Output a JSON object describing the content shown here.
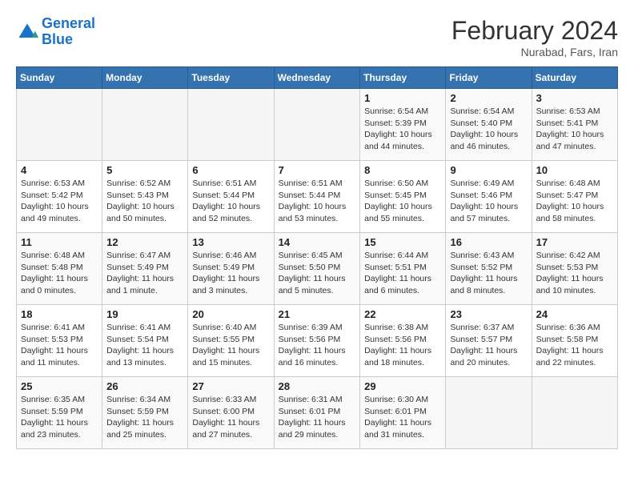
{
  "header": {
    "logo_line1": "General",
    "logo_line2": "Blue",
    "month_title": "February 2024",
    "location": "Nurabad, Fars, Iran"
  },
  "weekdays": [
    "Sunday",
    "Monday",
    "Tuesday",
    "Wednesday",
    "Thursday",
    "Friday",
    "Saturday"
  ],
  "weeks": [
    [
      {
        "day": "",
        "info": ""
      },
      {
        "day": "",
        "info": ""
      },
      {
        "day": "",
        "info": ""
      },
      {
        "day": "",
        "info": ""
      },
      {
        "day": "1",
        "info": "Sunrise: 6:54 AM\nSunset: 5:39 PM\nDaylight: 10 hours\nand 44 minutes."
      },
      {
        "day": "2",
        "info": "Sunrise: 6:54 AM\nSunset: 5:40 PM\nDaylight: 10 hours\nand 46 minutes."
      },
      {
        "day": "3",
        "info": "Sunrise: 6:53 AM\nSunset: 5:41 PM\nDaylight: 10 hours\nand 47 minutes."
      }
    ],
    [
      {
        "day": "4",
        "info": "Sunrise: 6:53 AM\nSunset: 5:42 PM\nDaylight: 10 hours\nand 49 minutes."
      },
      {
        "day": "5",
        "info": "Sunrise: 6:52 AM\nSunset: 5:43 PM\nDaylight: 10 hours\nand 50 minutes."
      },
      {
        "day": "6",
        "info": "Sunrise: 6:51 AM\nSunset: 5:44 PM\nDaylight: 10 hours\nand 52 minutes."
      },
      {
        "day": "7",
        "info": "Sunrise: 6:51 AM\nSunset: 5:44 PM\nDaylight: 10 hours\nand 53 minutes."
      },
      {
        "day": "8",
        "info": "Sunrise: 6:50 AM\nSunset: 5:45 PM\nDaylight: 10 hours\nand 55 minutes."
      },
      {
        "day": "9",
        "info": "Sunrise: 6:49 AM\nSunset: 5:46 PM\nDaylight: 10 hours\nand 57 minutes."
      },
      {
        "day": "10",
        "info": "Sunrise: 6:48 AM\nSunset: 5:47 PM\nDaylight: 10 hours\nand 58 minutes."
      }
    ],
    [
      {
        "day": "11",
        "info": "Sunrise: 6:48 AM\nSunset: 5:48 PM\nDaylight: 11 hours\nand 0 minutes."
      },
      {
        "day": "12",
        "info": "Sunrise: 6:47 AM\nSunset: 5:49 PM\nDaylight: 11 hours\nand 1 minute."
      },
      {
        "day": "13",
        "info": "Sunrise: 6:46 AM\nSunset: 5:49 PM\nDaylight: 11 hours\nand 3 minutes."
      },
      {
        "day": "14",
        "info": "Sunrise: 6:45 AM\nSunset: 5:50 PM\nDaylight: 11 hours\nand 5 minutes."
      },
      {
        "day": "15",
        "info": "Sunrise: 6:44 AM\nSunset: 5:51 PM\nDaylight: 11 hours\nand 6 minutes."
      },
      {
        "day": "16",
        "info": "Sunrise: 6:43 AM\nSunset: 5:52 PM\nDaylight: 11 hours\nand 8 minutes."
      },
      {
        "day": "17",
        "info": "Sunrise: 6:42 AM\nSunset: 5:53 PM\nDaylight: 11 hours\nand 10 minutes."
      }
    ],
    [
      {
        "day": "18",
        "info": "Sunrise: 6:41 AM\nSunset: 5:53 PM\nDaylight: 11 hours\nand 11 minutes."
      },
      {
        "day": "19",
        "info": "Sunrise: 6:41 AM\nSunset: 5:54 PM\nDaylight: 11 hours\nand 13 minutes."
      },
      {
        "day": "20",
        "info": "Sunrise: 6:40 AM\nSunset: 5:55 PM\nDaylight: 11 hours\nand 15 minutes."
      },
      {
        "day": "21",
        "info": "Sunrise: 6:39 AM\nSunset: 5:56 PM\nDaylight: 11 hours\nand 16 minutes."
      },
      {
        "day": "22",
        "info": "Sunrise: 6:38 AM\nSunset: 5:56 PM\nDaylight: 11 hours\nand 18 minutes."
      },
      {
        "day": "23",
        "info": "Sunrise: 6:37 AM\nSunset: 5:57 PM\nDaylight: 11 hours\nand 20 minutes."
      },
      {
        "day": "24",
        "info": "Sunrise: 6:36 AM\nSunset: 5:58 PM\nDaylight: 11 hours\nand 22 minutes."
      }
    ],
    [
      {
        "day": "25",
        "info": "Sunrise: 6:35 AM\nSunset: 5:59 PM\nDaylight: 11 hours\nand 23 minutes."
      },
      {
        "day": "26",
        "info": "Sunrise: 6:34 AM\nSunset: 5:59 PM\nDaylight: 11 hours\nand 25 minutes."
      },
      {
        "day": "27",
        "info": "Sunrise: 6:33 AM\nSunset: 6:00 PM\nDaylight: 11 hours\nand 27 minutes."
      },
      {
        "day": "28",
        "info": "Sunrise: 6:31 AM\nSunset: 6:01 PM\nDaylight: 11 hours\nand 29 minutes."
      },
      {
        "day": "29",
        "info": "Sunrise: 6:30 AM\nSunset: 6:01 PM\nDaylight: 11 hours\nand 31 minutes."
      },
      {
        "day": "",
        "info": ""
      },
      {
        "day": "",
        "info": ""
      }
    ]
  ]
}
